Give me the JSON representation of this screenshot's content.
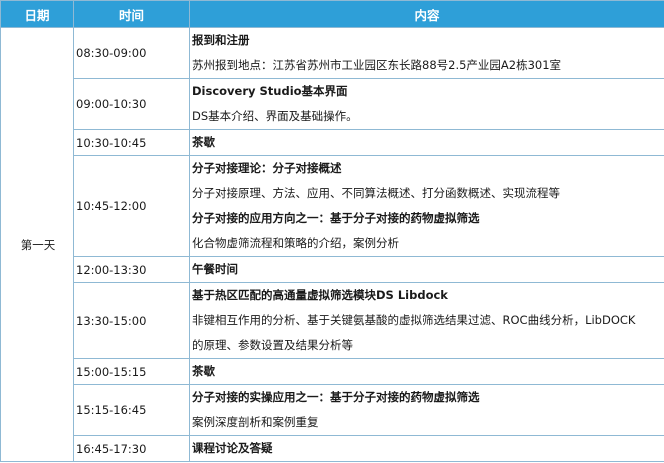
{
  "headers": {
    "date": "日期",
    "time": "时间",
    "content": "内容"
  },
  "day": "第一天",
  "rows": [
    {
      "time": "08:30-09:00",
      "lines": [
        {
          "text": "报到和注册",
          "bold": true
        },
        {
          "text": "苏州报到地点：江苏省苏州市工业园区东长路88号2.5产业园A2栋301室",
          "bold": false
        }
      ]
    },
    {
      "time": "09:00-10:30",
      "lines": [
        {
          "text": "Discovery Studio基本界面",
          "bold": true
        },
        {
          "text": "DS基本介绍、界面及基础操作。",
          "bold": false
        }
      ]
    },
    {
      "time": "10:30-10:45",
      "lines": [
        {
          "text": "茶歇",
          "bold": true
        }
      ]
    },
    {
      "time": "10:45-12:00",
      "lines": [
        {
          "text": "分子对接理论：分子对接概述",
          "bold": true
        },
        {
          "text": "分子对接原理、方法、应用、不同算法概述、打分函数概述、实现流程等",
          "bold": false
        },
        {
          "text": "分子对接的应用方向之一：基于分子对接的药物虚拟筛选",
          "bold": true
        },
        {
          "text": "化合物虚筛流程和策略的介绍，案例分析",
          "bold": false
        }
      ]
    },
    {
      "time": "12:00-13:30",
      "lines": [
        {
          "text": "午餐时间",
          "bold": true
        }
      ]
    },
    {
      "time": "13:30-15:00",
      "lines": [
        {
          "text": "基于热区匹配的高通量虚拟筛选模块DS Libdock",
          "bold": true
        },
        {
          "text": "非键相互作用的分析、基于关键氨基酸的虚拟筛选结果过滤、ROC曲线分析，LibDOCK",
          "bold": false
        },
        {
          "text": "的原理、参数设置及结果分析等",
          "bold": false
        }
      ]
    },
    {
      "time": "15:00-15:15",
      "lines": [
        {
          "text": "茶歇",
          "bold": true
        }
      ]
    },
    {
      "time": "15:15-16:45",
      "lines": [
        {
          "text": "分子对接的实操应用之一：基于分子对接的药物虚拟筛选",
          "bold": true
        },
        {
          "text": "案例深度剖析和案例重复",
          "bold": false
        }
      ]
    },
    {
      "time": "16:45-17:30",
      "lines": [
        {
          "text": "课程讨论及答疑",
          "bold": true
        }
      ]
    }
  ]
}
